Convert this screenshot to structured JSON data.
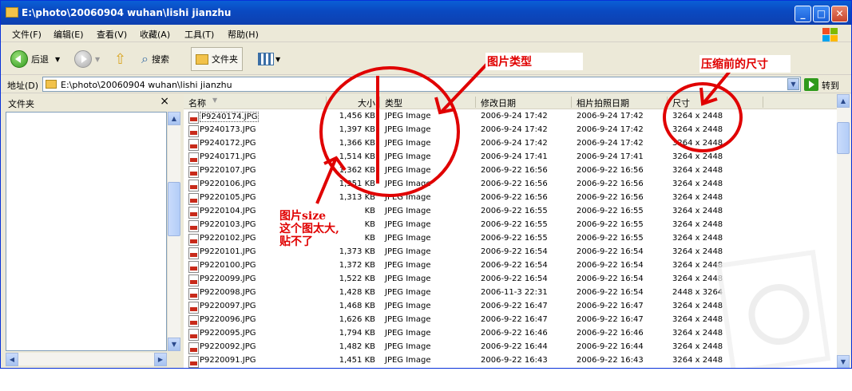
{
  "window": {
    "title": "E:\\photo\\20060904 wuhan\\lishi jianzhu",
    "accent": "#0a4ac2"
  },
  "menu": [
    "文件(F)",
    "编辑(E)",
    "查看(V)",
    "收藏(A)",
    "工具(T)",
    "帮助(H)"
  ],
  "toolbar": {
    "back": "后退",
    "search": "搜索",
    "folders": "文件夹"
  },
  "address": {
    "label": "地址(D)",
    "value": "E:\\photo\\20060904 wuhan\\lishi jianzhu",
    "go": "转到"
  },
  "folder_pane": {
    "title": "文件夹",
    "close": "×"
  },
  "columns": {
    "name": "名称",
    "size": "大小",
    "type": "类型",
    "modified": "修改日期",
    "taken": "相片拍照日期",
    "dimensions": "尺寸"
  },
  "files": [
    {
      "name": "P9240174.JPG",
      "size": "1,456 KB",
      "type": "JPEG Image",
      "modified": "2006-9-24 17:42",
      "taken": "2006-9-24 17:42",
      "dim": "3264 x 2448"
    },
    {
      "name": "P9240173.JPG",
      "size": "1,397 KB",
      "type": "JPEG Image",
      "modified": "2006-9-24 17:42",
      "taken": "2006-9-24 17:42",
      "dim": "3264 x 2448"
    },
    {
      "name": "P9240172.JPG",
      "size": "1,366 KB",
      "type": "JPEG Image",
      "modified": "2006-9-24 17:42",
      "taken": "2006-9-24 17:42",
      "dim": "3264 x 2448"
    },
    {
      "name": "P9240171.JPG",
      "size": "1,514 KB",
      "type": "JPEG Image",
      "modified": "2006-9-24 17:41",
      "taken": "2006-9-24 17:41",
      "dim": "3264 x 2448"
    },
    {
      "name": "P9220107.JPG",
      "size": "1,362 KB",
      "type": "JPEG Image",
      "modified": "2006-9-22 16:56",
      "taken": "2006-9-22 16:56",
      "dim": "3264 x 2448"
    },
    {
      "name": "P9220106.JPG",
      "size": "1,351 KB",
      "type": "JPEG Image",
      "modified": "2006-9-22 16:56",
      "taken": "2006-9-22 16:56",
      "dim": "3264 x 2448"
    },
    {
      "name": "P9220105.JPG",
      "size": "1,313 KB",
      "type": "JPEG Image",
      "modified": "2006-9-22 16:56",
      "taken": "2006-9-22 16:56",
      "dim": "3264 x 2448"
    },
    {
      "name": "P9220104.JPG",
      "size": "KB",
      "type": "JPEG Image",
      "modified": "2006-9-22 16:55",
      "taken": "2006-9-22 16:55",
      "dim": "3264 x 2448"
    },
    {
      "name": "P9220103.JPG",
      "size": "KB",
      "type": "JPEG Image",
      "modified": "2006-9-22 16:55",
      "taken": "2006-9-22 16:55",
      "dim": "3264 x 2448"
    },
    {
      "name": "P9220102.JPG",
      "size": "KB",
      "type": "JPEG Image",
      "modified": "2006-9-22 16:55",
      "taken": "2006-9-22 16:55",
      "dim": "3264 x 2448"
    },
    {
      "name": "P9220101.JPG",
      "size": "1,373 KB",
      "type": "JPEG Image",
      "modified": "2006-9-22 16:54",
      "taken": "2006-9-22 16:54",
      "dim": "3264 x 2448"
    },
    {
      "name": "P9220100.JPG",
      "size": "1,372 KB",
      "type": "JPEG Image",
      "modified": "2006-9-22 16:54",
      "taken": "2006-9-22 16:54",
      "dim": "3264 x 2448"
    },
    {
      "name": "P9220099.JPG",
      "size": "1,522 KB",
      "type": "JPEG Image",
      "modified": "2006-9-22 16:54",
      "taken": "2006-9-22 16:54",
      "dim": "3264 x 2448"
    },
    {
      "name": "P9220098.JPG",
      "size": "1,428 KB",
      "type": "JPEG Image",
      "modified": "2006-11-3 22:31",
      "taken": "2006-9-22 16:54",
      "dim": "2448 x 3264"
    },
    {
      "name": "P9220097.JPG",
      "size": "1,468 KB",
      "type": "JPEG Image",
      "modified": "2006-9-22 16:47",
      "taken": "2006-9-22 16:47",
      "dim": "3264 x 2448"
    },
    {
      "name": "P9220096.JPG",
      "size": "1,626 KB",
      "type": "JPEG Image",
      "modified": "2006-9-22 16:47",
      "taken": "2006-9-22 16:47",
      "dim": "3264 x 2448"
    },
    {
      "name": "P9220095.JPG",
      "size": "1,794 KB",
      "type": "JPEG Image",
      "modified": "2006-9-22 16:46",
      "taken": "2006-9-22 16:46",
      "dim": "3264 x 2448"
    },
    {
      "name": "P9220092.JPG",
      "size": "1,482 KB",
      "type": "JPEG Image",
      "modified": "2006-9-22 16:44",
      "taken": "2006-9-22 16:44",
      "dim": "3264 x 2448"
    },
    {
      "name": "P9220091.JPG",
      "size": "1,451 KB",
      "type": "JPEG Image",
      "modified": "2006-9-22 16:43",
      "taken": "2006-9-22 16:43",
      "dim": "3264 x 2448"
    }
  ],
  "annotations": {
    "type_note": "图片类型",
    "dim_note": "压缩前的尺寸",
    "size_note_1": "图片size",
    "size_note_2": "这个图太大,",
    "size_note_3": "贴不了",
    "color": "#e00000"
  }
}
